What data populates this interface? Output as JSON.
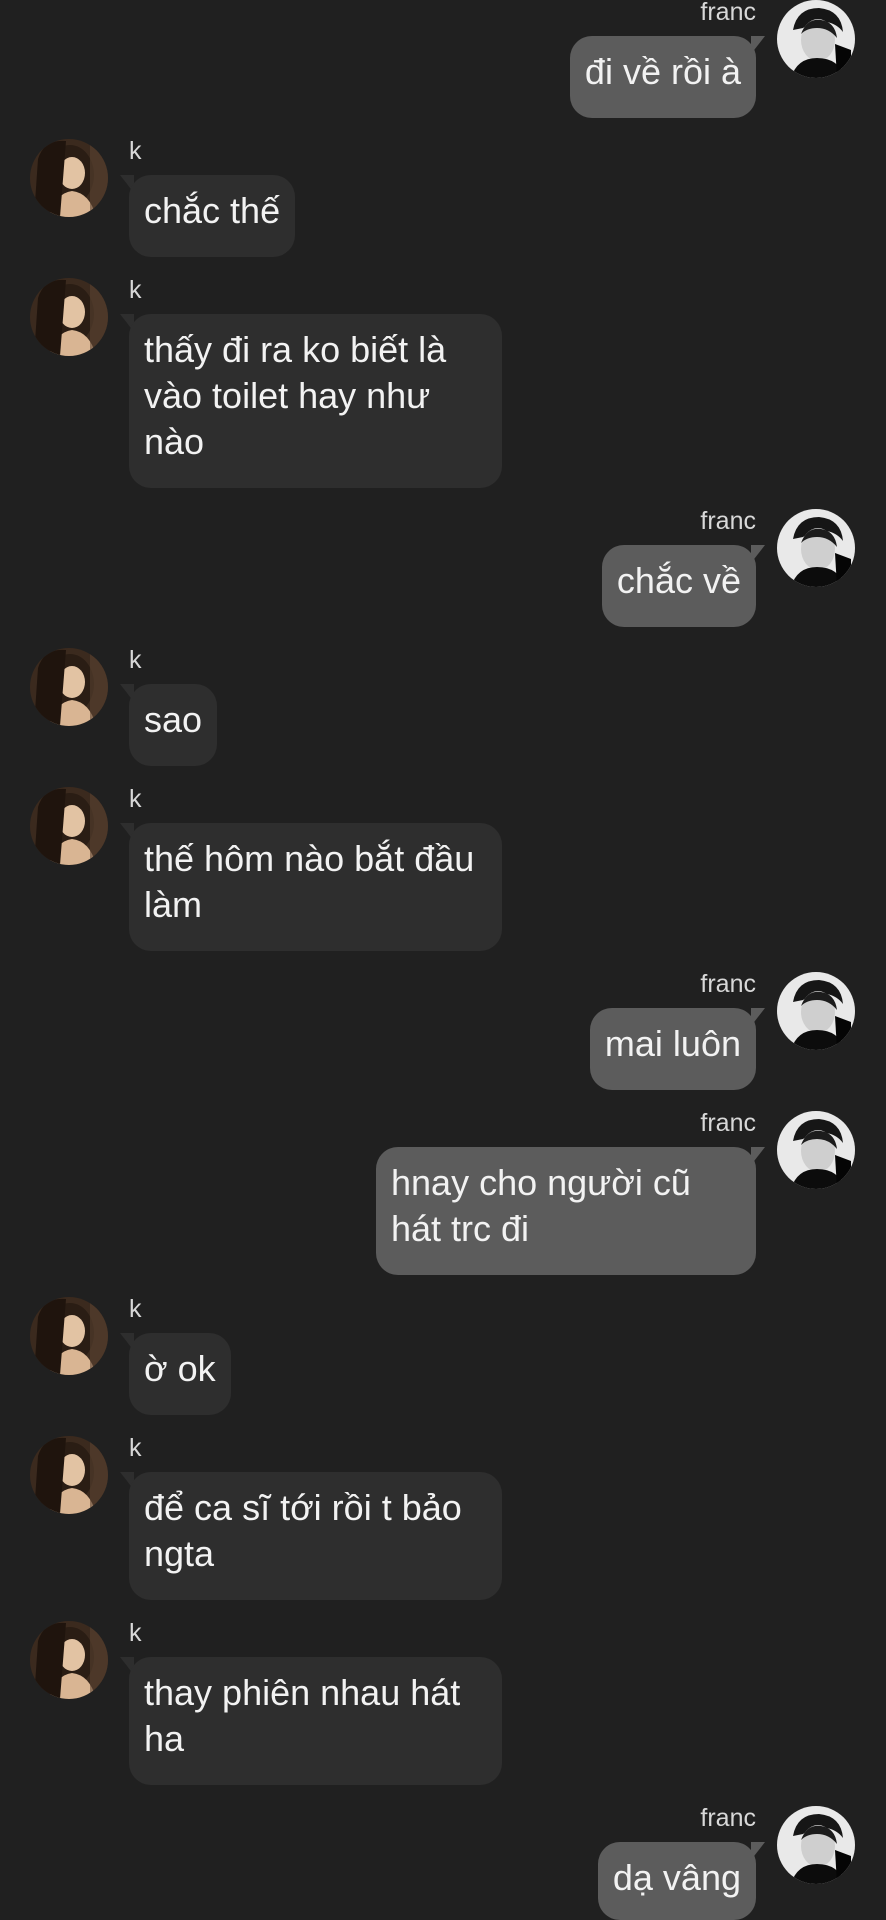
{
  "users": {
    "k": {
      "name": "k"
    },
    "franc": {
      "name": "franc"
    }
  },
  "messages": [
    {
      "sender": "franc",
      "direction": "out",
      "text": "đi về rồi à"
    },
    {
      "sender": "k",
      "direction": "in",
      "text": "chắc thế"
    },
    {
      "sender": "k",
      "direction": "in",
      "text": "thấy đi ra ko biết là vào toilet hay như nào"
    },
    {
      "sender": "franc",
      "direction": "out",
      "text": "chắc về"
    },
    {
      "sender": "k",
      "direction": "in",
      "text": "sao"
    },
    {
      "sender": "k",
      "direction": "in",
      "text": "thế hôm nào bắt đầu làm"
    },
    {
      "sender": "franc",
      "direction": "out",
      "text": "mai luôn"
    },
    {
      "sender": "franc",
      "direction": "out",
      "text": "hnay cho người cũ hát trc đi"
    },
    {
      "sender": "k",
      "direction": "in",
      "text": "ờ ok"
    },
    {
      "sender": "k",
      "direction": "in",
      "text": "để ca sĩ tới rồi t bảo ngta"
    },
    {
      "sender": "k",
      "direction": "in",
      "text": "thay phiên nhau hát ha"
    },
    {
      "sender": "franc",
      "direction": "out",
      "text": "dạ vâng"
    }
  ],
  "theme": {
    "background": "#202020",
    "incoming_bubble": "#2e2e2e",
    "outgoing_bubble": "#5c5c5c",
    "text": "#f2f2f2",
    "name_text": "#d8d8d8"
  },
  "icons": {
    "k_avatar": "avatar-photo",
    "franc_avatar": "avatar-photo"
  }
}
